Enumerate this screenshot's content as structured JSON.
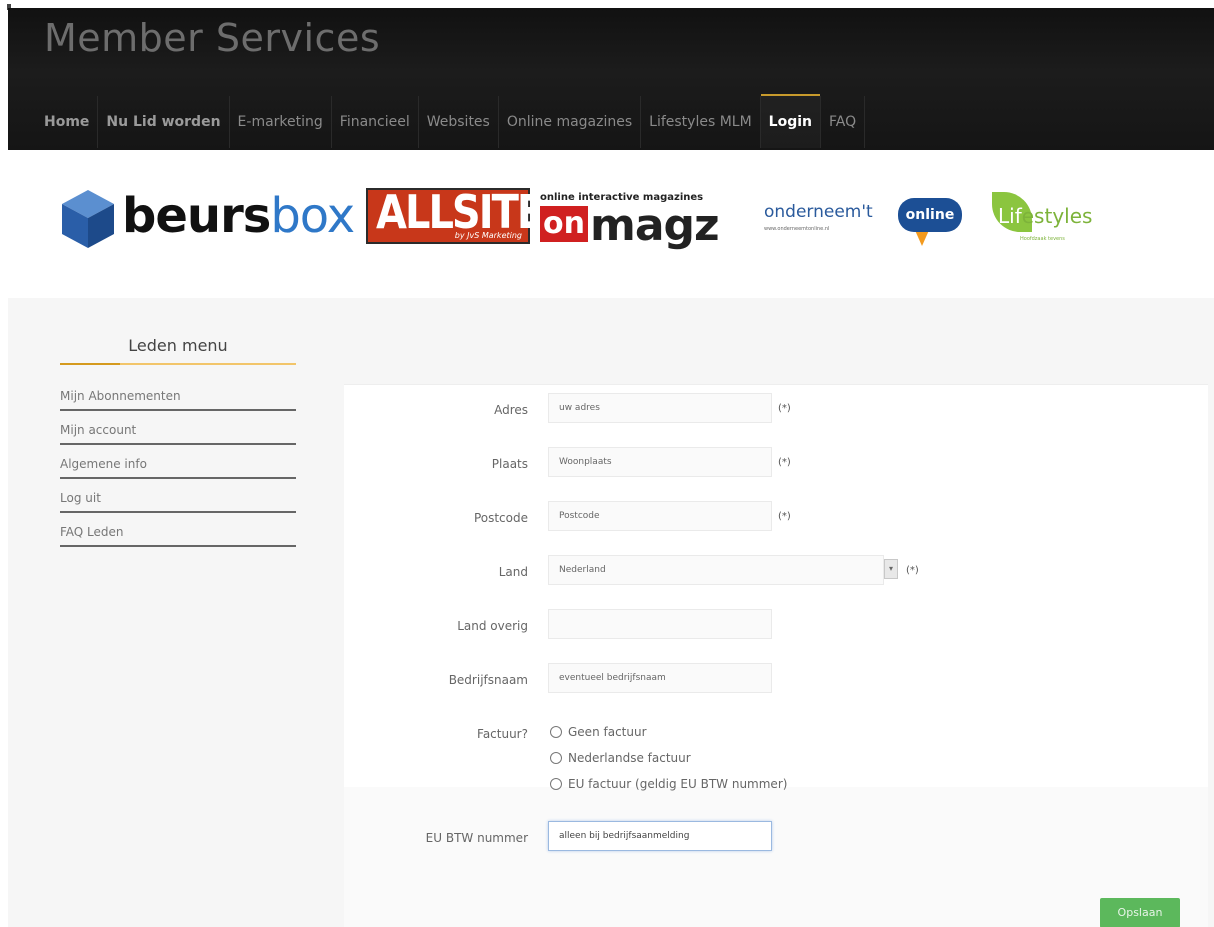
{
  "header": {
    "title": "Member Services",
    "nav": [
      {
        "label": "Home"
      },
      {
        "label": "Nu Lid worden"
      },
      {
        "label": "E-marketing"
      },
      {
        "label": "Financieel"
      },
      {
        "label": "Websites"
      },
      {
        "label": "Online magazines"
      },
      {
        "label": "Lifestyles MLM"
      },
      {
        "label": "Login"
      },
      {
        "label": "FAQ"
      }
    ],
    "active_nav": "Login"
  },
  "logos": {
    "beursbox": {
      "part1": "beurs",
      "part2": "box"
    },
    "allsites": {
      "name": "ALLSITES",
      "sub": "by JvS Marketing"
    },
    "onmagz": {
      "tagline": "online interactive magazines",
      "on": "on",
      "magz": "magz"
    },
    "onderneem": {
      "name": "onderneem't",
      "url": "www.onderneemtonline.nl",
      "badge": "online"
    },
    "lifestyles": {
      "lf": "Lif",
      "rest": "estyles",
      "sub": "Hoofdzaak tevens"
    }
  },
  "sidebar": {
    "title": "Leden menu",
    "items": [
      {
        "label": "Mijn Abonnementen"
      },
      {
        "label": "Mijn account"
      },
      {
        "label": "Algemene info"
      },
      {
        "label": "Log uit"
      },
      {
        "label": "FAQ Leden"
      }
    ]
  },
  "form": {
    "required_mark": "(*)",
    "adres": {
      "label": "Adres",
      "placeholder": "uw adres"
    },
    "plaats": {
      "label": "Plaats",
      "placeholder": "Woonplaats"
    },
    "postcode": {
      "label": "Postcode",
      "placeholder": "Postcode"
    },
    "land": {
      "label": "Land",
      "value": "Nederland"
    },
    "land_overig": {
      "label": "Land overig",
      "value": ""
    },
    "bedrijfsnaam": {
      "label": "Bedrijfsnaam",
      "placeholder": "eventueel bedrijfsnaam"
    },
    "factuur": {
      "label": "Factuur?",
      "options": [
        {
          "label": "Geen factuur"
        },
        {
          "label": "Nederlandse factuur"
        },
        {
          "label": "EU factuur (geldig EU BTW nummer)"
        }
      ]
    },
    "eu_btw": {
      "label": "EU BTW nummer",
      "value": "alleen bij bedrijfsaanmelding"
    },
    "save_label": "Opslaan"
  },
  "colors": {
    "header_bg": "#151515",
    "active_accent": "#c79a2c",
    "sidebar_accent": "#f2c56a",
    "save_button": "#5cb85c",
    "panel_bg": "#f6f6f6"
  }
}
